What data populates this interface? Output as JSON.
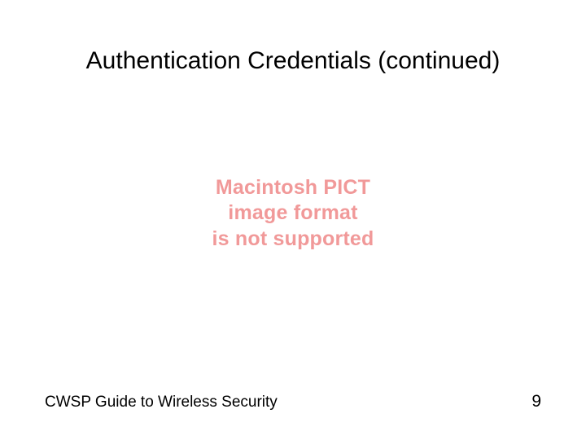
{
  "slide": {
    "title": "Authentication Credentials (continued)",
    "error_line1": "Macintosh PICT",
    "error_line2": "image format",
    "error_line3": "is not supported"
  },
  "footer": {
    "text": "CWSP Guide to Wireless Security",
    "page": "9"
  }
}
